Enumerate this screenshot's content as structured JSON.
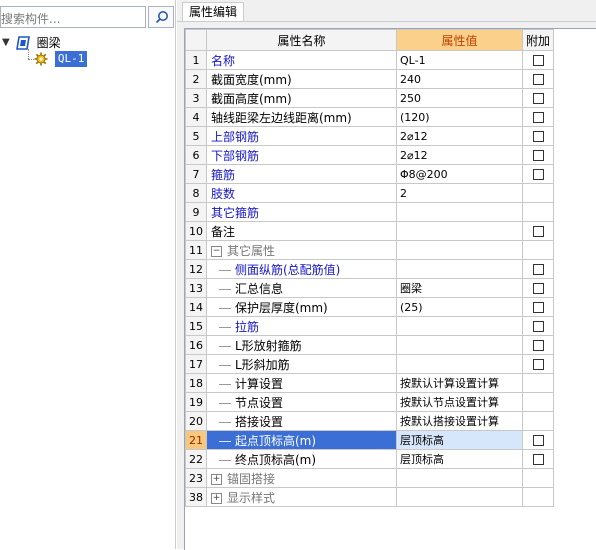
{
  "search": {
    "placeholder": "搜索构件..."
  },
  "tree": {
    "root_label": "圈梁",
    "child_label": "QL-1"
  },
  "panel": {
    "tab_label": "属性编辑"
  },
  "grid": {
    "headers": {
      "name": "属性名称",
      "value": "属性值",
      "extra": "附加"
    },
    "rows": [
      {
        "num": "1",
        "name": "名称",
        "value": "QL-1"
      },
      {
        "num": "2",
        "name": "截面宽度(mm)",
        "value": "240"
      },
      {
        "num": "3",
        "name": "截面高度(mm)",
        "value": "250"
      },
      {
        "num": "4",
        "name": "轴线距梁左边线距离(mm)",
        "value": "(120)"
      },
      {
        "num": "5",
        "name": "上部钢筋",
        "value": "2⌀12"
      },
      {
        "num": "6",
        "name": "下部钢筋",
        "value": "2⌀12"
      },
      {
        "num": "7",
        "name": "箍筋",
        "value": "Φ8@200"
      },
      {
        "num": "8",
        "name": "肢数",
        "value": "2"
      },
      {
        "num": "9",
        "name": "其它箍筋",
        "value": ""
      },
      {
        "num": "10",
        "name": "备注",
        "value": ""
      },
      {
        "num": "11",
        "name": "其它属性",
        "value": "",
        "group_state": "−"
      },
      {
        "num": "12",
        "name": "侧面纵筋(总配筋值)",
        "value": ""
      },
      {
        "num": "13",
        "name": "汇总信息",
        "value": "圈梁"
      },
      {
        "num": "14",
        "name": "保护层厚度(mm)",
        "value": "(25)"
      },
      {
        "num": "15",
        "name": "拉筋",
        "value": ""
      },
      {
        "num": "16",
        "name": "L形放射箍筋",
        "value": ""
      },
      {
        "num": "17",
        "name": "L形斜加筋",
        "value": ""
      },
      {
        "num": "18",
        "name": "计算设置",
        "value": "按默认计算设置计算"
      },
      {
        "num": "19",
        "name": "节点设置",
        "value": "按默认节点设置计算"
      },
      {
        "num": "20",
        "name": "搭接设置",
        "value": "按默认搭接设置计算"
      },
      {
        "num": "21",
        "name": "起点顶标高(m)",
        "value": "层顶标高"
      },
      {
        "num": "22",
        "name": "终点顶标高(m)",
        "value": "层顶标高"
      },
      {
        "num": "23",
        "name": "锚固搭接",
        "value": "",
        "group_state": "+"
      },
      {
        "num": "38",
        "name": "显示样式",
        "value": "",
        "group_state": "+"
      }
    ]
  },
  "colors": {
    "accent_blue": "#3b6fd6",
    "header_value_bg": "#fbd08a",
    "blue_text": "#1515c8"
  },
  "icons": [
    "search-icon",
    "beam-category-icon",
    "component-gear-icon",
    "checkbox",
    "collapse-icon",
    "expand-icon"
  ]
}
